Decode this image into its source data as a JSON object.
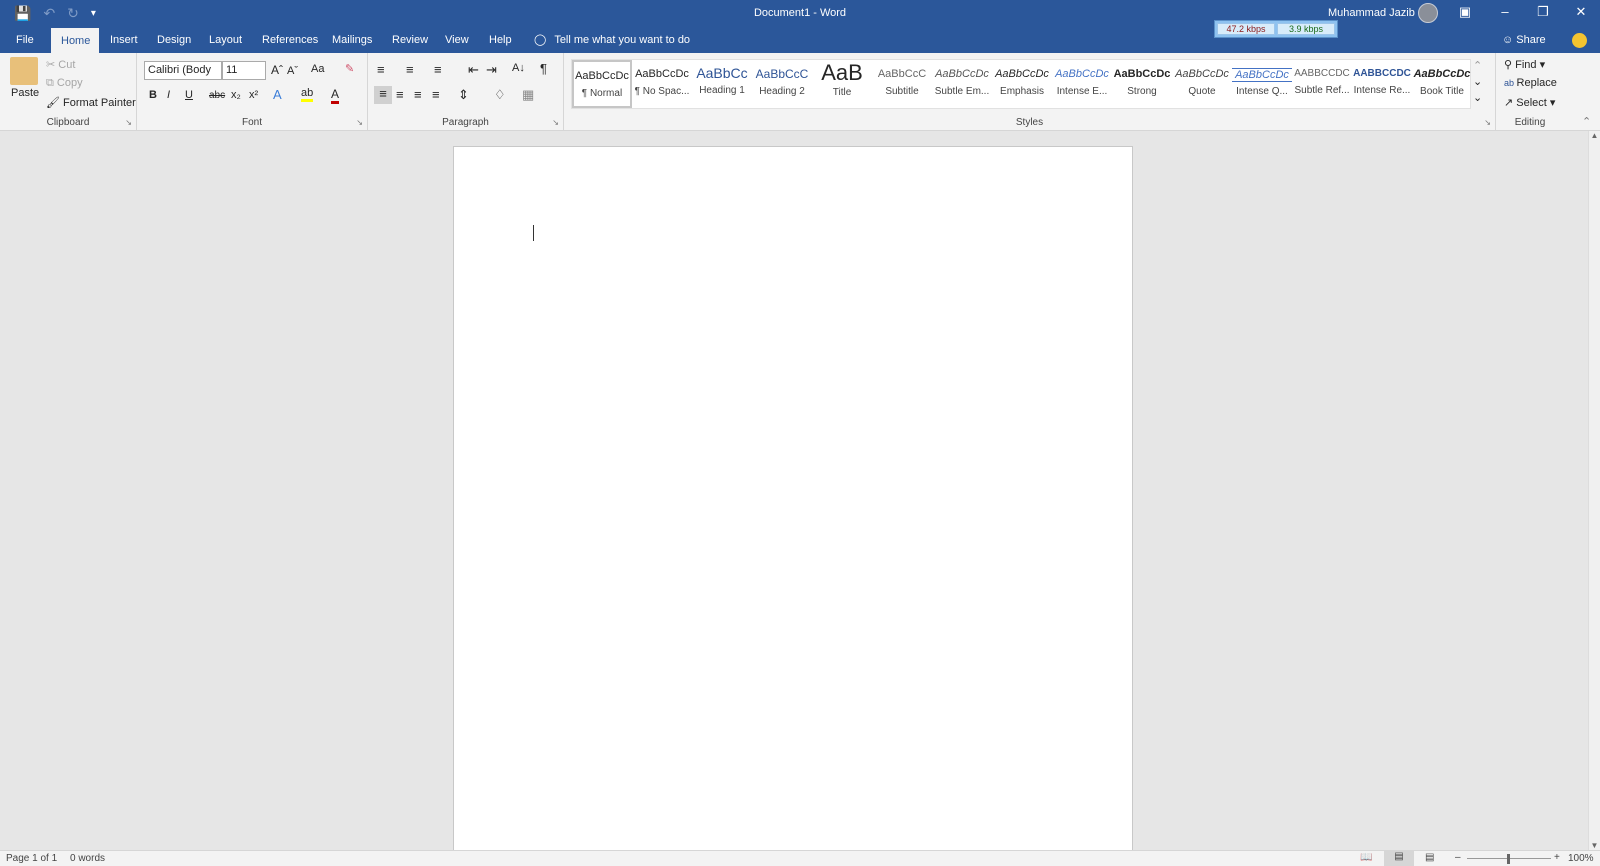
{
  "window": {
    "title": "Document1  -  Word",
    "user": "Muhammad Jazib",
    "net_down": "47.2 kbps",
    "net_up": "3.9 kbps"
  },
  "qat": {
    "save": "save-icon",
    "undo": "undo-icon",
    "redo": "redo-icon",
    "customize": "customize-icon"
  },
  "tabs": [
    "File",
    "Home",
    "Insert",
    "Design",
    "Layout",
    "References",
    "Mailings",
    "Review",
    "View",
    "Help"
  ],
  "tellme": "Tell me what you want to do",
  "share": "Share",
  "clipboard": {
    "paste": "Paste",
    "cut": "Cut",
    "copy": "Copy",
    "format_painter": "Format Painter",
    "label": "Clipboard"
  },
  "font": {
    "name": "Calibri (Body",
    "size": "11",
    "label": "Font",
    "bold": "B",
    "italic": "I",
    "underline": "U",
    "strike": "abc",
    "sub": "x₂",
    "sup": "x²",
    "case": "Aa"
  },
  "paragraph": {
    "label": "Paragraph",
    "pilcrow": "¶"
  },
  "styles": {
    "label": "Styles",
    "items": [
      {
        "preview": "AaBbCcDc",
        "name": "¶ Normal"
      },
      {
        "preview": "AaBbCcDc",
        "name": "¶ No Spac..."
      },
      {
        "preview": "AaBbCc",
        "name": "Heading 1"
      },
      {
        "preview": "AaBbCcC",
        "name": "Heading 2"
      },
      {
        "preview": "AaB",
        "name": "Title"
      },
      {
        "preview": "AaBbCcC",
        "name": "Subtitle"
      },
      {
        "preview": "AaBbCcDc",
        "name": "Subtle Em..."
      },
      {
        "preview": "AaBbCcDc",
        "name": "Emphasis"
      },
      {
        "preview": "AaBbCcDc",
        "name": "Intense E..."
      },
      {
        "preview": "AaBbCcDc",
        "name": "Strong"
      },
      {
        "preview": "AaBbCcDc",
        "name": "Quote"
      },
      {
        "preview": "AaBbCcDc",
        "name": "Intense Q..."
      },
      {
        "preview": "AABBCCDC",
        "name": "Subtle Ref..."
      },
      {
        "preview": "AABBCCDC",
        "name": "Intense Re..."
      },
      {
        "preview": "AaBbCcDc",
        "name": "Book Title"
      }
    ]
  },
  "editing": {
    "find": "Find",
    "replace": "Replace",
    "select": "Select",
    "label": "Editing"
  },
  "status": {
    "page": "Page 1 of 1",
    "words": "0 words",
    "zoom": "100%"
  }
}
